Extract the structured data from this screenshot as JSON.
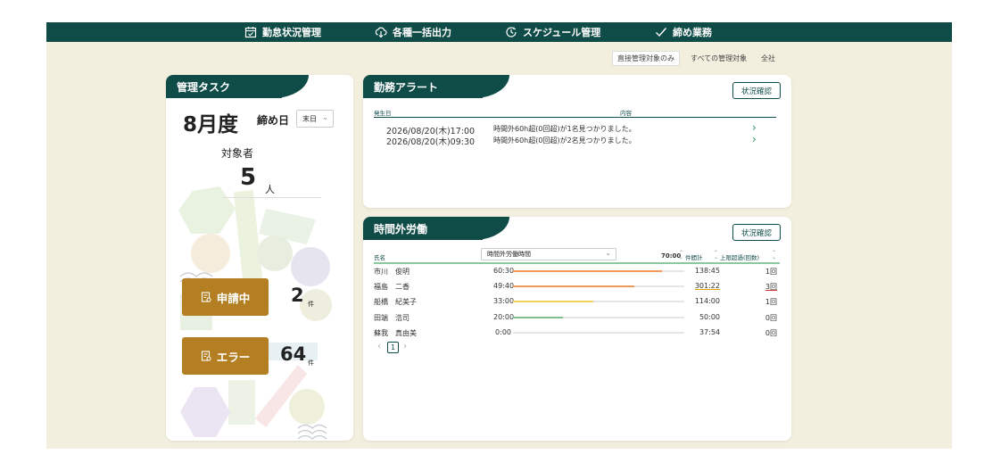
{
  "nav": [
    {
      "label": "勤怠状況管理",
      "icon": "calendar-icon"
    },
    {
      "label": "各種一括出力",
      "icon": "cloud-download-icon"
    },
    {
      "label": "スケジュール管理",
      "icon": "clock-icon"
    },
    {
      "label": "締め業務",
      "icon": "check-icon"
    }
  ],
  "scope_tabs": [
    "直接管理対象のみ",
    "すべての管理対象",
    "全社"
  ],
  "tasks": {
    "title": "管理タスク",
    "month": "8月度",
    "closing_label": "締め日",
    "closing_value": "末日",
    "target_label": "対象者",
    "target_count": "5",
    "target_unit": "人",
    "pending_label": "申請中",
    "pending_count": "2",
    "error_label": "エラー",
    "error_count": "64",
    "count_unit": "件"
  },
  "alerts": {
    "title": "勤務アラート",
    "confirm": "状況確認",
    "col_date": "発生日",
    "col_content": "内容",
    "rows": [
      {
        "date": "2026/08/20(木)17:00",
        "content": "時間外60h超(0回超)が1名見つかりました。"
      },
      {
        "date": "2026/08/20(木)09:30",
        "content": "時間外60h超(0回超)が2名見つかりました。"
      }
    ]
  },
  "overtime": {
    "title": "時間外労働",
    "confirm": "状況確認",
    "col_name": "氏名",
    "select_value": "時間外労働時間",
    "limit": "70:00",
    "col_total": "件間計",
    "col_over": "上限超過(回数)",
    "rows": [
      {
        "name": "市川　俊明",
        "time": "60:30",
        "progress": 0.87,
        "color": "#ee9a5c",
        "total": "138:45",
        "over": "1回"
      },
      {
        "name": "福島　二香",
        "time": "49:40",
        "progress": 0.71,
        "color": "#ee9a5c",
        "total": "301:22",
        "over": "3回"
      },
      {
        "name": "船橋　紀美子",
        "time": "33:00",
        "progress": 0.47,
        "color": "#f1d35a",
        "total": "114:00",
        "over": "1回"
      },
      {
        "name": "田端　浩司",
        "time": "20:00",
        "progress": 0.29,
        "color": "#7fbf8a",
        "total": "50:00",
        "over": "0回"
      },
      {
        "name": "蘇我　真由美",
        "time": "0:00",
        "progress": 0,
        "color": "#7fbf8a",
        "total": "37:54",
        "over": "0回"
      }
    ],
    "page": "1"
  }
}
